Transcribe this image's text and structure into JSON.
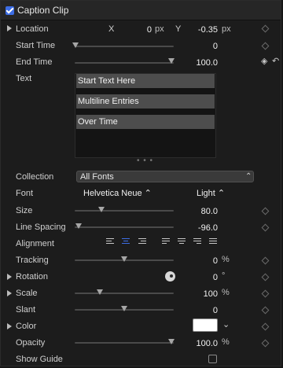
{
  "header": {
    "title": "Caption Clip",
    "enabled": true
  },
  "location": {
    "label": "Location",
    "x_label": "X",
    "x_value": "0",
    "x_unit": "px",
    "y_label": "Y",
    "y_value": "-0.35",
    "y_unit": "px"
  },
  "start_time": {
    "label": "Start Time",
    "value": "0",
    "slider_fraction": 0.0
  },
  "end_time": {
    "label": "End Time",
    "value": "100.0",
    "slider_fraction": 1.0
  },
  "text": {
    "label": "Text",
    "lines": [
      "Start Text Here",
      "Multiline Entries",
      "Over Time"
    ],
    "handle": "• • •"
  },
  "collection": {
    "label": "Collection",
    "value": "All Fonts"
  },
  "font": {
    "label": "Font",
    "family": "Helvetica Neue ⌃",
    "weight": "Light ⌃"
  },
  "size": {
    "label": "Size",
    "value": "80.0",
    "slider_fraction": 0.27
  },
  "line_spacing": {
    "label": "Line Spacing",
    "value": "-96.0",
    "slider_fraction": 0.03
  },
  "alignment": {
    "label": "Alignment",
    "selected": "center"
  },
  "tracking": {
    "label": "Tracking",
    "value": "0",
    "unit": "%",
    "slider_fraction": 0.5
  },
  "rotation": {
    "label": "Rotation",
    "value": "0",
    "unit": "°"
  },
  "scale": {
    "label": "Scale",
    "value": "100",
    "unit": "%",
    "slider_fraction": 0.25
  },
  "slant": {
    "label": "Slant",
    "value": "0",
    "slider_fraction": 0.5
  },
  "color": {
    "label": "Color",
    "swatch": "#ffffff"
  },
  "opacity": {
    "label": "Opacity",
    "value": "100.0",
    "unit": "%",
    "slider_fraction": 1.0
  },
  "show_guide": {
    "label": "Show Guide",
    "checked": false
  },
  "theme": {
    "accent": "#3d6ee6"
  }
}
